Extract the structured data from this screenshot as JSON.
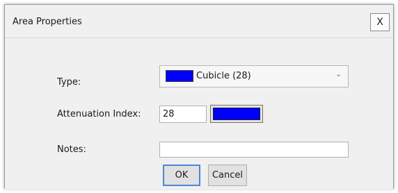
{
  "dialog": {
    "title": "Area Properties",
    "close_label": "X"
  },
  "form": {
    "type_label": "Type:",
    "type_value": "Cubicle (28)",
    "type_color": "#0000ff",
    "chevron_icon": "chevron-down-icon",
    "attenuation_label": "Attenuation Index:",
    "attenuation_value": "28",
    "attenuation_color": "#0000ff",
    "notes_label": "Notes:",
    "notes_value": ""
  },
  "buttons": {
    "ok": "OK",
    "cancel": "Cancel"
  }
}
